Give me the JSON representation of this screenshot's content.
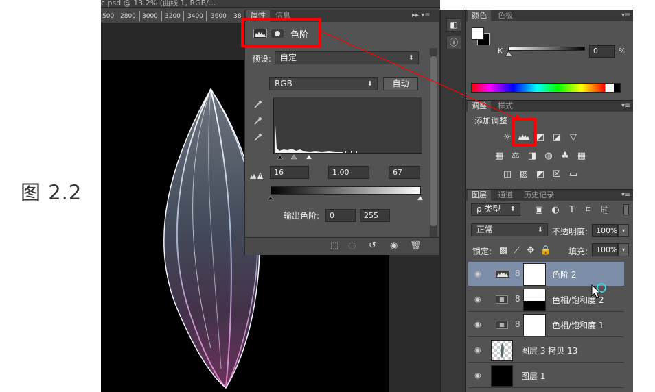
{
  "caption": "图 2.2",
  "document": {
    "tab_title": "c.psd @ 13.2% (曲线 1, RGB/...",
    "ruler_ticks": [
      "500",
      "2800",
      "3000",
      "3200",
      "3400",
      "3600",
      "38"
    ]
  },
  "properties_panel": {
    "tabs": [
      {
        "label": "属性",
        "active": true
      },
      {
        "label": "信息",
        "active": false
      }
    ],
    "menu_glyph": "▸▸ ▾≡",
    "title": "色阶",
    "preset_label": "预设:",
    "preset_value": "自定",
    "channel_value": "RGB",
    "auto_button": "自动",
    "input_levels": [
      "16",
      "1.00",
      "67"
    ],
    "output_label": "输出色阶:",
    "output_levels": [
      "0",
      "255"
    ]
  },
  "color_panel": {
    "tabs": [
      {
        "label": "颜色",
        "active": true
      },
      {
        "label": "色板",
        "active": false
      }
    ],
    "k_label": "K",
    "k_value": "0",
    "k_unit": "%"
  },
  "adjust_panel": {
    "tabs": [
      {
        "label": "调整",
        "active": true
      },
      {
        "label": "样式",
        "active": false
      }
    ],
    "title": "添加调整"
  },
  "layers_panel": {
    "tabs": [
      {
        "label": "图层",
        "active": true
      },
      {
        "label": "通道",
        "active": false
      },
      {
        "label": "历史记录",
        "active": false
      }
    ],
    "filter_kind": "ρ 类型",
    "blend_mode": "正常",
    "opacity_label": "不透明度:",
    "opacity_value": "100%",
    "lock_label": "锁定:",
    "fill_label": "填充:",
    "fill_value": "100%",
    "layers": [
      {
        "name": "色阶 2",
        "selected": true
      },
      {
        "name": "色相/饱和度 2",
        "selected": false
      },
      {
        "name": "色相/饱和度 1",
        "selected": false
      },
      {
        "name": "图层 3 拷贝 13",
        "selected": false
      },
      {
        "name": "图层 1",
        "selected": false
      }
    ]
  },
  "colors": {
    "panel_bg": "#535353",
    "selected_layer": "#7d8ea8",
    "annotation_red": "#ff0000"
  }
}
